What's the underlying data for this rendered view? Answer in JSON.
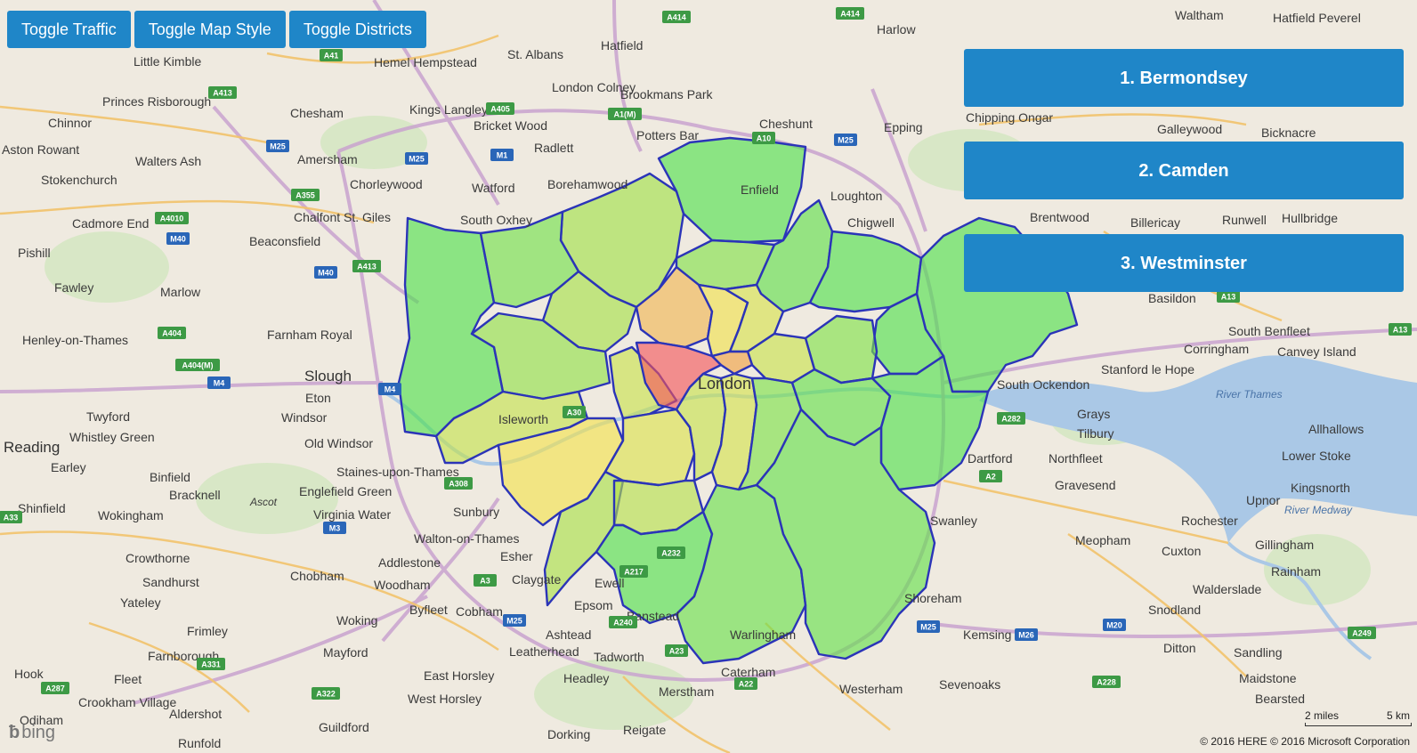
{
  "toolbar": {
    "toggle_traffic": "Toggle Traffic",
    "toggle_map_style": "Toggle Map Style",
    "toggle_districts": "Toggle Districts"
  },
  "rankings": [
    {
      "label": "1. Bermondsey"
    },
    {
      "label": "2. Camden"
    },
    {
      "label": "3. Westminster"
    }
  ],
  "map": {
    "central_label": "London",
    "place_labels": [
      "Enfield",
      "Harlow",
      "Hatfield",
      "St. Albans",
      "Hemel Hempstead",
      "Kings Langley",
      "London Colney",
      "Brookmans Park",
      "Potters Bar",
      "Cheshunt",
      "Epping",
      "Chipping Ongar",
      "Galleywood",
      "Bicknacre",
      "Hatfield Peverel",
      "Waltham",
      "Watford",
      "Borehamwood",
      "Radlett",
      "Bricket Wood",
      "Chesham",
      "Amersham",
      "Chorleywood",
      "Chalfont St. Giles",
      "South Oxhey",
      "Beaconsfield",
      "Loughton",
      "Chigwell",
      "Brentwood",
      "Billericay",
      "Runwell",
      "Hullbridge",
      "Basildon",
      "South Benfleet",
      "Corringham",
      "Canvey Island",
      "Stanford le Hope",
      "South Ockendon",
      "Grays",
      "Tilbury",
      "Northfleet",
      "Gravesend",
      "Dartford",
      "Swanley",
      "Allhallows",
      "Lower Stoke",
      "Kingsnorth",
      "Upnor",
      "Rochester",
      "Gillingham",
      "Rainham",
      "Cuxton",
      "Meopham",
      "Walderslade",
      "Snodland",
      "Ditton",
      "Sandling",
      "Maidstone",
      "Bearsted",
      "Kemsing",
      "Sevenoaks",
      "Westerham",
      "Shoreham",
      "Warlingham",
      "Caterham",
      "Merstham",
      "Reigate",
      "Dorking",
      "Headley",
      "Tadworth",
      "Banstead",
      "Epsom",
      "Ewell",
      "Ashtead",
      "Leatherhead",
      "Claygate",
      "Esher",
      "Walton-on-Thames",
      "Addlestone",
      "Woodham",
      "Byfleet",
      "Cobham",
      "Woking",
      "Chobham",
      "Mayford",
      "Guildford",
      "East Horsley",
      "West Horsley",
      "Sunbury",
      "Staines-upon-Thames",
      "Englefield Green",
      "Virginia Water",
      "Old Windsor",
      "Windsor",
      "Eton",
      "Slough",
      "Isleworth",
      "Farnham Royal",
      "Marlow",
      "Henley-on-Thames",
      "Twyford",
      "Whistley Green",
      "Reading",
      "Earley",
      "Binfield",
      "Bracknell",
      "Ascot",
      "Shinfield",
      "Wokingham",
      "Crowthorne",
      "Sandhurst",
      "Yateley",
      "Frimley",
      "Farnborough",
      "Fleet",
      "Crookham Village",
      "Aldershot",
      "Hook",
      "Odiham",
      "Runfold",
      "Princes Risborough",
      "Chinnor",
      "Aston Rowant",
      "Walters Ash",
      "Stokenchurch",
      "Cadmore End",
      "Pishill",
      "Fawley",
      "Little Kimble"
    ],
    "water_labels": [
      "River Thames",
      "River Medway"
    ],
    "road_shields": [
      "A414",
      "A414",
      "A41",
      "A405",
      "A1(M)",
      "M25",
      "M1",
      "A10",
      "M25",
      "A413",
      "A413",
      "M25",
      "A355",
      "A4010",
      "M40",
      "M40",
      "A413",
      "A404",
      "A404(M)",
      "M4",
      "M4",
      "A30",
      "A308",
      "M3",
      "M25",
      "A3",
      "A217",
      "A232",
      "A240",
      "A23",
      "A22",
      "M25",
      "M26",
      "M20",
      "A249",
      "A228",
      "A2",
      "A13",
      "A13",
      "A282",
      "A322",
      "A331",
      "A287",
      "A33"
    ],
    "bing_logo": "bing",
    "scale_miles": "2 miles",
    "scale_km": "5 km",
    "copyright": "© 2016 HERE   © 2016 Microsoft Corporation"
  },
  "colors": {
    "button_blue": "#1f86c8",
    "district_border": "#2b34b8",
    "land": "#efeae0",
    "water": "#aac8e6",
    "heat_low": "#4ee04a",
    "heat_mid": "#f4e24a",
    "heat_high": "#f0a040",
    "heat_max": "#f2243a"
  }
}
